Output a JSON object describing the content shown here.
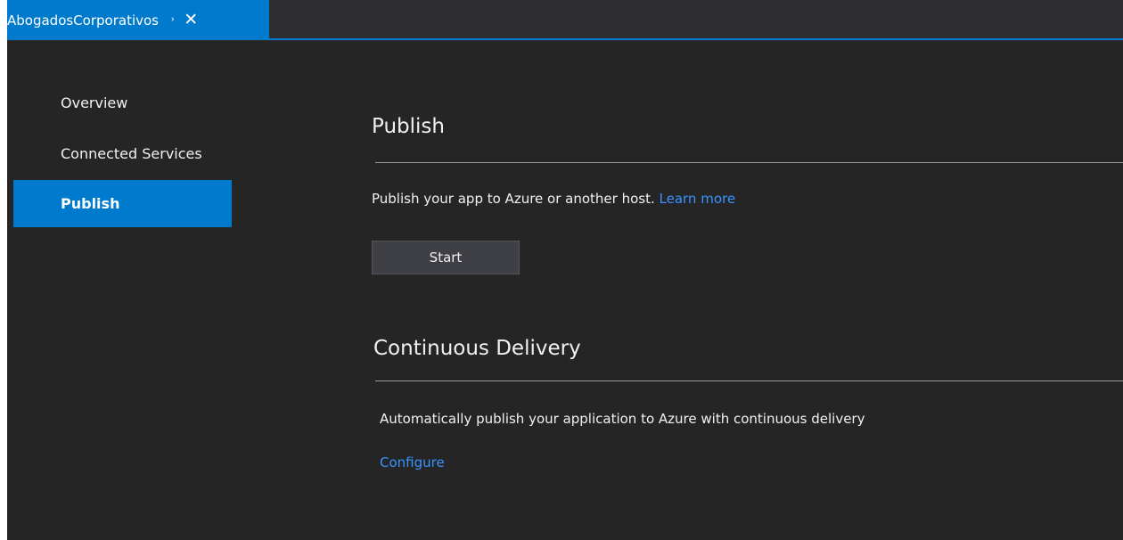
{
  "tab": {
    "title": "AbogadosCorporativos",
    "pin_icon": "pin-icon",
    "close_icon": "close-icon"
  },
  "sidebar": {
    "items": [
      {
        "label": "Overview",
        "active": false
      },
      {
        "label": "Connected Services",
        "active": false
      },
      {
        "label": "Publish",
        "active": true
      }
    ]
  },
  "publish": {
    "heading": "Publish",
    "description": "Publish your app to Azure or another host.",
    "learn_more": "Learn more",
    "start_label": "Start"
  },
  "delivery": {
    "heading": "Continuous Delivery",
    "description": "Automatically publish your application to Azure with continuous delivery",
    "configure_label": "Configure"
  },
  "colors": {
    "accent": "#007acc",
    "background": "#252526",
    "link": "#3794ff",
    "text": "#f1f1f1"
  }
}
